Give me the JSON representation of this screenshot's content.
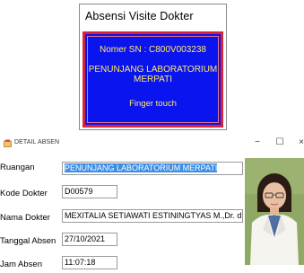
{
  "top_dialog": {
    "title": "Absensi Visite Dokter",
    "serial": "Nomer SN : C800V003238",
    "unit_name": "PENUNJANG LABORATORIUM MERPATI",
    "status": "Finger touch",
    "colors": {
      "panel": "#0a14ee",
      "border": "#d6243a",
      "text": "#ffe86a"
    }
  },
  "window": {
    "title": "DETAIL ABSEN",
    "icons": [
      "app-icon",
      "minimize-icon",
      "maximize-icon",
      "close-icon"
    ],
    "controls": {
      "minimize": "−",
      "maximize": "☐",
      "close": "×"
    }
  },
  "form": {
    "ruangan": {
      "label": "Ruangan",
      "value": "PENUNJANG LABORATORIUM MERPATI"
    },
    "kode_dokter": {
      "label": "Kode Dokter",
      "value": "D00579"
    },
    "nama_dokter": {
      "label": "Nama Dokter",
      "value": "MEXITALIA SETIAWATI ESTININGTYAS M.,Dr. dr.,Sp.A("
    },
    "tanggal_absen": {
      "label": "Tanggal Absen",
      "value": "27/10/2021"
    },
    "jam_absen": {
      "label": "Jam Absen",
      "value": "11:07:18"
    }
  }
}
